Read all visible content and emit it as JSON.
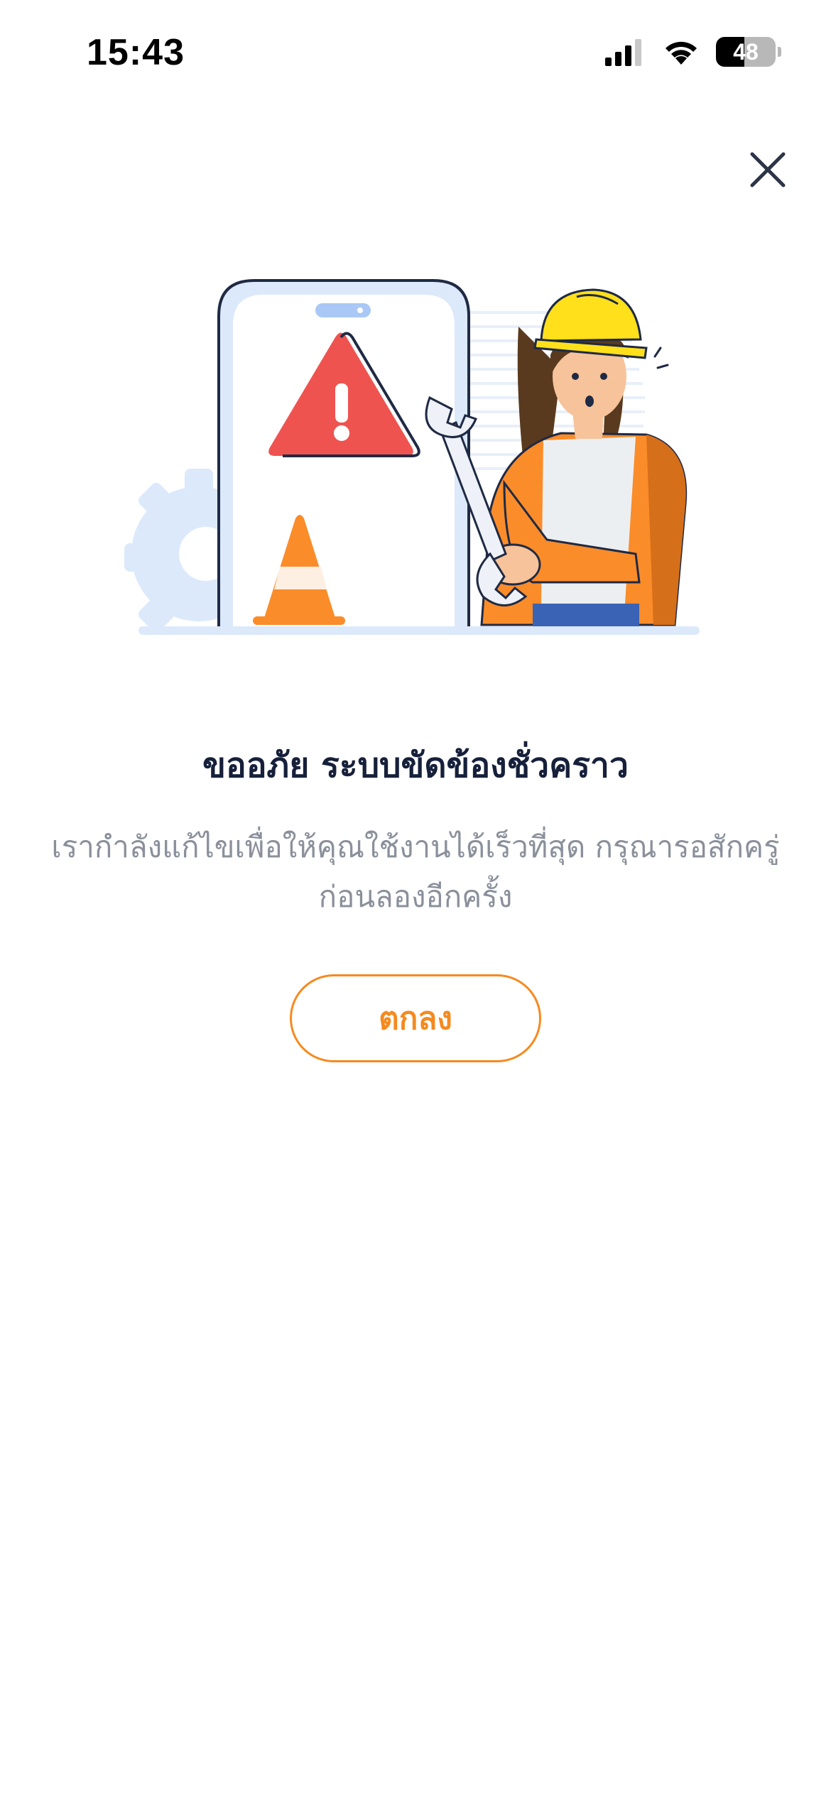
{
  "status_bar": {
    "time": "15:43",
    "battery_level": "48",
    "icons": [
      "signal-icon",
      "wifi-icon",
      "battery-icon"
    ]
  },
  "dialog": {
    "close_icon": "close-icon",
    "illustration": "maintenance-illustration",
    "title": "ขออภัย ระบบขัดข้องชั่วคราว",
    "message": "เรากำลังแก้ไขเพื่อให้คุณใช้งานได้เร็วที่สุด กรุณารอสักครู่ก่อนลองอีกครั้ง",
    "ok_label": "ตกลง"
  },
  "colors": {
    "accent": "#f58a1f",
    "title": "#16203a",
    "message": "#8a909b",
    "alert_red": "#ef5350",
    "helmet_yellow": "#ffe01b",
    "light_blue": "#dce9fb"
  }
}
